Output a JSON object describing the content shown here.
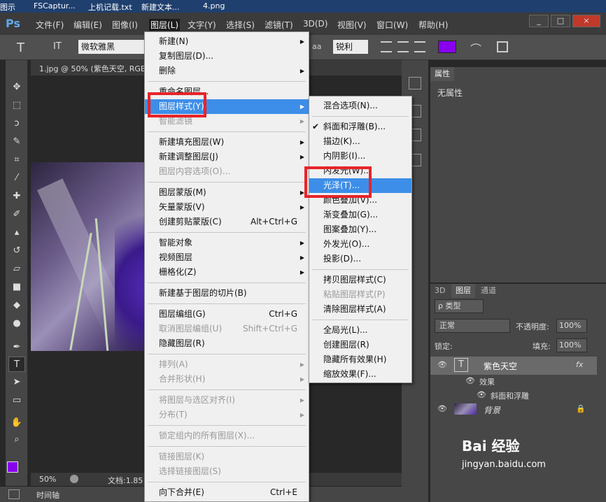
{
  "taskbar": {
    "items": [
      "图示",
      "FSCaptur...",
      "上机记载.txt",
      "新建文本...",
      "4.png"
    ]
  },
  "app": {
    "logo": "Ps",
    "menu": [
      "文件(F)",
      "编辑(E)",
      "图像(I)",
      "图层(L)",
      "文字(Y)",
      "选择(S)",
      "滤镜(T)",
      "3D(D)",
      "视图(V)",
      "窗口(W)",
      "帮助(H)"
    ],
    "window_buttons": [
      "_",
      "□",
      "×"
    ]
  },
  "options": {
    "tool_icon": "T",
    "orient_icon": "IT",
    "font": "微软雅黑",
    "aa": "aa",
    "aa_mode": "锐利",
    "color": "#8800ee"
  },
  "document": {
    "tab_title": "1.jpg @ 50% (紫色天空, RGB",
    "zoom": "50%",
    "doc_info": "文档:1.85"
  },
  "timeline": {
    "label": "时间轴"
  },
  "properties": {
    "tab": "属性",
    "content": "无属性"
  },
  "layers_panel": {
    "tabs": [
      "3D",
      "图层",
      "通道"
    ],
    "filter_label": "ρ 类型",
    "blend_mode": "正常",
    "opacity_label": "不透明度:",
    "opacity_value": "100%",
    "lock_label": "锁定:",
    "fill_label": "填充:",
    "fill_value": "100%",
    "layers": [
      {
        "name": "紫色天空",
        "type": "text",
        "fx": "fx"
      },
      {
        "name": "效果",
        "type": "effects"
      },
      {
        "name": "斜面和浮雕",
        "type": "effect"
      },
      {
        "name": "背景",
        "type": "background"
      }
    ]
  },
  "layer_menu": [
    {
      "label": "新建(N)",
      "arrow": true
    },
    {
      "label": "复制图层(D)..."
    },
    {
      "label": "删除",
      "arrow": true
    },
    {
      "sep": true
    },
    {
      "label": "重命名图层..."
    },
    {
      "label": "图层样式(Y)",
      "arrow": true,
      "highlight": true
    },
    {
      "label": "智能滤镜",
      "disabled": true,
      "arrow": true
    },
    {
      "sep": true
    },
    {
      "label": "新建填充图层(W)",
      "arrow": true
    },
    {
      "label": "新建调整图层(J)",
      "arrow": true
    },
    {
      "label": "图层内容选项(O)...",
      "disabled": true
    },
    {
      "sep": true
    },
    {
      "label": "图层蒙版(M)",
      "arrow": true
    },
    {
      "label": "矢量蒙版(V)",
      "arrow": true
    },
    {
      "label": "创建剪贴蒙版(C)",
      "shortcut": "Alt+Ctrl+G"
    },
    {
      "sep": true
    },
    {
      "label": "智能对象",
      "arrow": true
    },
    {
      "label": "视频图层",
      "arrow": true
    },
    {
      "label": "栅格化(Z)",
      "arrow": true
    },
    {
      "sep": true
    },
    {
      "label": "新建基于图层的切片(B)"
    },
    {
      "sep": true
    },
    {
      "label": "图层编组(G)",
      "shortcut": "Ctrl+G"
    },
    {
      "label": "取消图层编组(U)",
      "shortcut": "Shift+Ctrl+G",
      "disabled": true
    },
    {
      "label": "隐藏图层(R)"
    },
    {
      "sep": true
    },
    {
      "label": "排列(A)",
      "arrow": true,
      "disabled": true
    },
    {
      "label": "合并形状(H)",
      "arrow": true,
      "disabled": true
    },
    {
      "sep": true
    },
    {
      "label": "将图层与选区对齐(I)",
      "arrow": true,
      "disabled": true
    },
    {
      "label": "分布(T)",
      "arrow": true,
      "disabled": true
    },
    {
      "sep": true
    },
    {
      "label": "锁定组内的所有图层(X)...",
      "disabled": true
    },
    {
      "sep": true
    },
    {
      "label": "链接图层(K)",
      "disabled": true
    },
    {
      "label": "选择链接图层(S)",
      "disabled": true
    },
    {
      "sep": true
    },
    {
      "label": "向下合并(E)",
      "shortcut": "Ctrl+E"
    }
  ],
  "style_submenu": [
    {
      "label": "混合选项(N)..."
    },
    {
      "sep": true
    },
    {
      "label": "斜面和浮雕(B)...",
      "checked": true
    },
    {
      "label": "描边(K)..."
    },
    {
      "label": "内阴影(I)..."
    },
    {
      "label": "内发光(W)..."
    },
    {
      "label": "光泽(T)...",
      "highlight": true
    },
    {
      "label": "颜色叠加(V)..."
    },
    {
      "label": "渐变叠加(G)..."
    },
    {
      "label": "图案叠加(Y)..."
    },
    {
      "label": "外发光(O)..."
    },
    {
      "label": "投影(D)..."
    },
    {
      "sep": true
    },
    {
      "label": "拷贝图层样式(C)"
    },
    {
      "label": "粘贴图层样式(P)",
      "disabled": true
    },
    {
      "label": "清除图层样式(A)"
    },
    {
      "sep": true
    },
    {
      "label": "全局光(L)..."
    },
    {
      "label": "创建图层(R)"
    },
    {
      "label": "隐藏所有效果(H)"
    },
    {
      "label": "缩放效果(F)..."
    }
  ],
  "watermark": {
    "brand": "Bai 经验",
    "url": "jingyan.baidu.com"
  }
}
